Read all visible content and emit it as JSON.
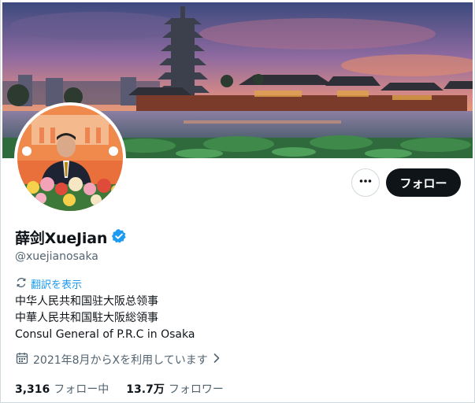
{
  "profile": {
    "display_name": "薛剑XueJian",
    "handle": "@xuejianosaka",
    "verified_icon": "verified-badge-icon",
    "follow_label": "フォロー",
    "translate_label": "翻訳を表示",
    "bio_lines": [
      "中华人民共和国驻大阪总领事",
      "中華人民共和国駐大阪総領事",
      "Consul General of P.R.C  in Osaka"
    ],
    "joined_text": "2021年8月からXを利用しています",
    "stats": {
      "following_count": "3,316",
      "following_label": "フォロー中",
      "followers_count": "13.7万",
      "followers_label": "フォロワー"
    }
  },
  "colors": {
    "accent": "#1d9bf0",
    "button_dark": "#0f1419",
    "muted_text": "#536471"
  }
}
